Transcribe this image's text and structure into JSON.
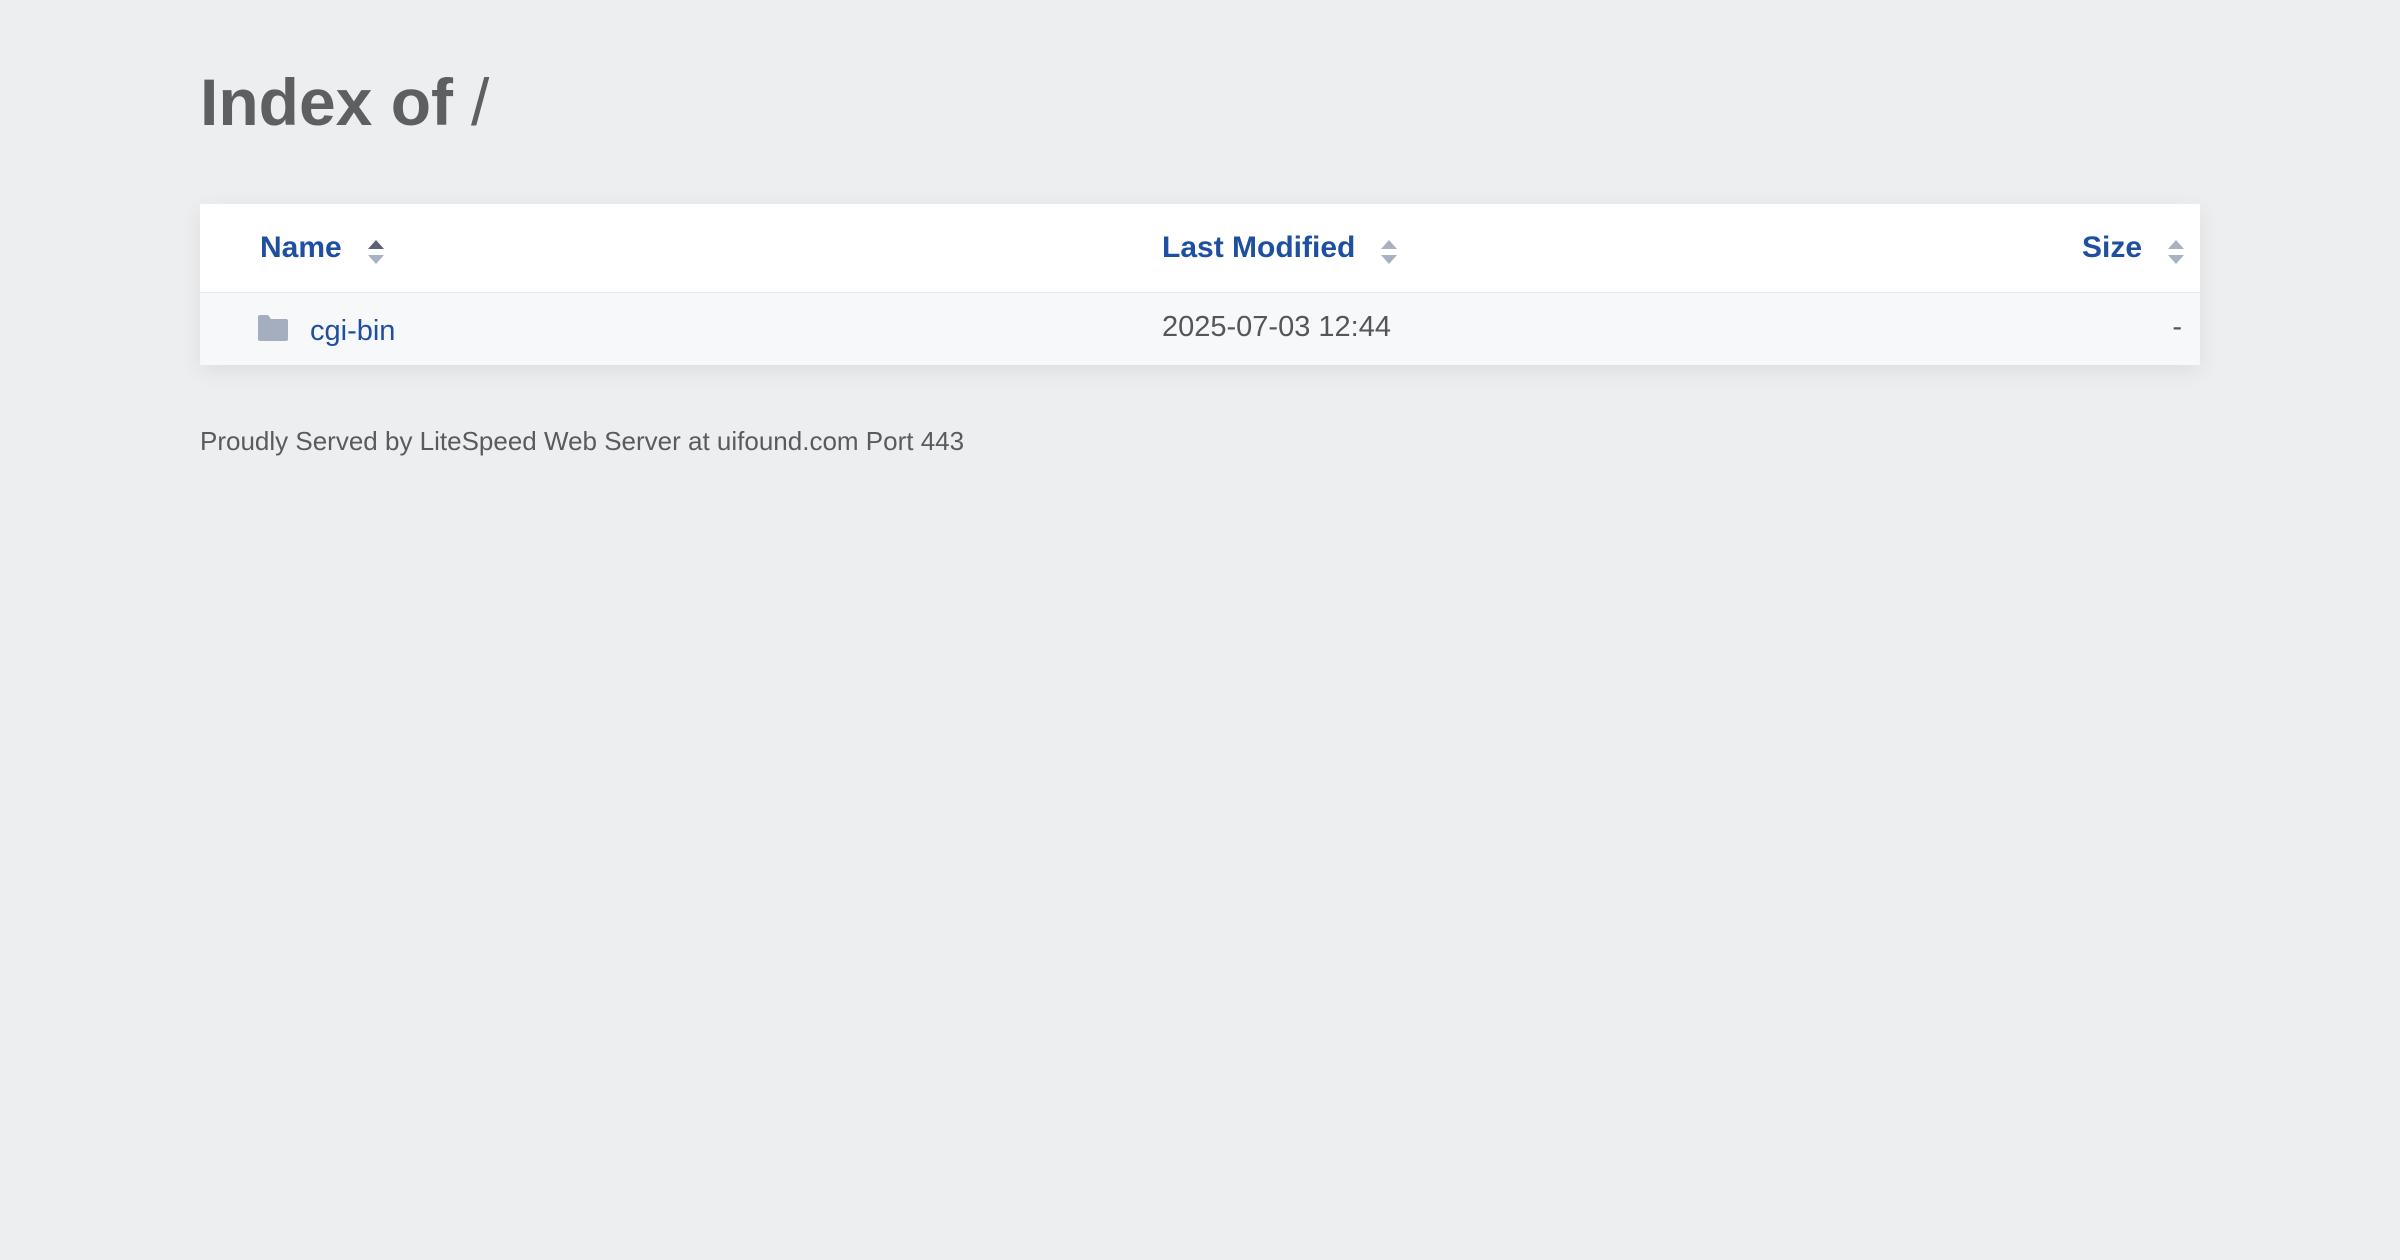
{
  "page": {
    "title_bold": "Index of",
    "title_path": "/"
  },
  "table": {
    "columns": [
      {
        "label": "Name",
        "sort_icon": "sort-icon",
        "sort_active": true
      },
      {
        "label": "Last Modified",
        "sort_icon": "sort-icon",
        "sort_active": false
      },
      {
        "label": "Size",
        "sort_icon": "sort-icon",
        "sort_active": false
      }
    ],
    "rows": [
      {
        "icon": "folder-icon",
        "name": "cgi-bin",
        "last_modified": "2025-07-03 12:44",
        "size": "-"
      }
    ]
  },
  "footer": {
    "text": "Proudly Served by LiteSpeed Web Server at uifound.com Port 443"
  },
  "colors": {
    "background": "#edeef0",
    "link": "#1f4fa1",
    "folder": "#a5aebf",
    "title": "#5e5f60"
  }
}
